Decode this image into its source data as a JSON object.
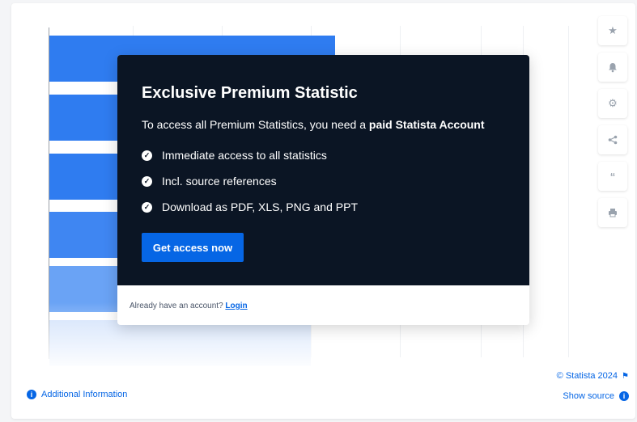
{
  "modal": {
    "title": "Exclusive Premium Statistic",
    "subtitle_prefix": "To access all Premium Statistics, you need a ",
    "subtitle_bold": "paid Statista Account",
    "features": [
      "Immediate access to all statistics",
      "Incl. source references",
      "Download as PDF, XLS, PNG and PPT"
    ],
    "cta_label": "Get access now",
    "login_prompt": "Already have an account? ",
    "login_label": "Login"
  },
  "tools": [
    "star-icon",
    "bell-icon",
    "gear-icon",
    "share-icon",
    "quote-icon",
    "print-icon"
  ],
  "footer": {
    "additional_info": "Additional Information",
    "credit": "© Statista 2024",
    "show_source": "Show source"
  },
  "colors": {
    "accent": "#0666e5",
    "modal_bg": "#0b1524",
    "bar": "#2f7cf0"
  }
}
